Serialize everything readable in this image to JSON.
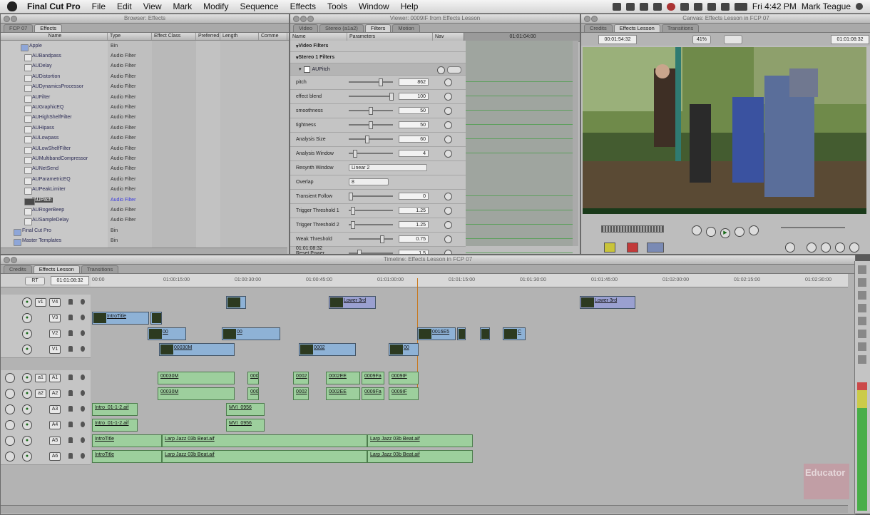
{
  "menubar": {
    "app_name": "Final Cut Pro",
    "items": [
      "File",
      "Edit",
      "View",
      "Mark",
      "Modify",
      "Sequence",
      "Effects",
      "Tools",
      "Window",
      "Help"
    ],
    "clock": "Fri 4:42 PM",
    "user": "Mark Teague"
  },
  "browser": {
    "title": "Browser: Effects",
    "tabs": [
      "FCP 07",
      "Effects"
    ],
    "columns": [
      "Name",
      "Type",
      "Effect Class",
      "Preferred",
      "Length",
      "Comme"
    ],
    "rows": [
      {
        "name": "Apple",
        "type": "Bin"
      },
      {
        "name": "AUBandpass",
        "type": "Audio Filter"
      },
      {
        "name": "AUDelay",
        "type": "Audio Filter"
      },
      {
        "name": "AUDistortion",
        "type": "Audio Filter"
      },
      {
        "name": "AUDynamicsProcessor",
        "type": "Audio Filter"
      },
      {
        "name": "AUFilter",
        "type": "Audio Filter"
      },
      {
        "name": "AUGraphicEQ",
        "type": "Audio Filter"
      },
      {
        "name": "AUHighShelfFilter",
        "type": "Audio Filter"
      },
      {
        "name": "AUHipass",
        "type": "Audio Filter"
      },
      {
        "name": "AULowpass",
        "type": "Audio Filter"
      },
      {
        "name": "AULowShelfFilter",
        "type": "Audio Filter"
      },
      {
        "name": "AUMultibandCompressor",
        "type": "Audio Filter"
      },
      {
        "name": "AUNetSend",
        "type": "Audio Filter"
      },
      {
        "name": "AUParametricEQ",
        "type": "Audio Filter"
      },
      {
        "name": "AUPeakLimiter",
        "type": "Audio Filter"
      },
      {
        "name": "AUPitch",
        "type": "Audio Filter"
      },
      {
        "name": "AURogerBeep",
        "type": "Audio Filter"
      },
      {
        "name": "AUSampleDelay",
        "type": "Audio Filter"
      },
      {
        "name": "Final Cut Pro",
        "type": "Bin"
      },
      {
        "name": "Master Templates",
        "type": "Bin"
      }
    ],
    "selected_index": 15
  },
  "viewer": {
    "title": "Viewer: 0009IF from Effects Lesson",
    "tabs": [
      "Video",
      "Stereo (a1a2)",
      "Filters",
      "Motion"
    ],
    "header": {
      "name": "Name",
      "params": "Parameters",
      "nav": "Nav"
    },
    "timecode_ruler": "01:01:04:00",
    "groups": [
      "Video Filters",
      "Stereo 1 Filters"
    ],
    "filter_name": "AUPitch",
    "params": [
      {
        "name": "pitch",
        "value": "862",
        "pos": 0.72
      },
      {
        "name": "effect blend",
        "value": "100",
        "pos": 0.98
      },
      {
        "name": "smoothness",
        "value": "50",
        "pos": 0.48
      },
      {
        "name": "tightness",
        "value": "50",
        "pos": 0.48
      },
      {
        "name": "Analysis Size",
        "value": "60",
        "pos": 0.4
      },
      {
        "name": "Analysis Window",
        "value": "4",
        "pos": 0.1
      },
      {
        "name": "Resynth Window",
        "select": "Linear 2"
      },
      {
        "name": "Overlap",
        "select": "8"
      },
      {
        "name": "Transient Follow",
        "value": "0",
        "pos": 0.0
      },
      {
        "name": "Trigger Threshold 1",
        "value": "1.25",
        "pos": 0.05
      },
      {
        "name": "Trigger Threshold 2",
        "value": "1.25",
        "pos": 0.05
      },
      {
        "name": "Weak Threshold",
        "value": "0.75",
        "pos": 0.75
      },
      {
        "name": "Reset Power",
        "value": "1.5",
        "pos": 0.2
      }
    ],
    "current_timecode": "01:01:08:32"
  },
  "canvas": {
    "title": "Canvas: Effects Lesson in FCP 07",
    "tabs": [
      "Credits",
      "Effects Lesson",
      "Transitions"
    ],
    "timecode_left": "00:01:54:32",
    "zoom": "41%",
    "timecode_right": "01:01:08:32"
  },
  "timeline": {
    "title": "Timeline: Effects Lesson in FCP 07",
    "tabs": [
      "Credits",
      "Effects Lesson",
      "Transitions"
    ],
    "rt": "RT",
    "timecode": "01:01:08:32",
    "ruler": [
      "00:00",
      "01:00:15:00",
      "01:00:30:00",
      "01:00:45:00",
      "01:01:00:00",
      "01:01:15:00",
      "01:01:30:00",
      "01:01:45:00",
      "01:02:00:00",
      "01:02:15:00",
      "01:02:30:00"
    ],
    "video_tracks": [
      {
        "src": "v1",
        "dest": "V4",
        "clips": [
          {
            "label": ""
          },
          {
            "label": "Lower 3rd"
          },
          {
            "label": "Lower 3rd"
          }
        ]
      },
      {
        "src": "",
        "dest": "V3",
        "clips": [
          {
            "label": "IntroTitle"
          },
          {
            "label": "Cro"
          }
        ]
      },
      {
        "src": "",
        "dest": "V2",
        "clips": [
          {
            "label": "00"
          },
          {
            "label": "00"
          },
          {
            "label": "0016E5"
          },
          {
            "label": "Fa"
          },
          {
            "label": "N"
          },
          {
            "label": "C"
          }
        ]
      },
      {
        "src": "",
        "dest": "V1",
        "clips": [
          {
            "label": "00030M"
          },
          {
            "label": "0002"
          },
          {
            "label": "00"
          }
        ]
      }
    ],
    "audio_tracks": [
      {
        "src": "a1",
        "dest": "A1",
        "clips": [
          {
            "label": "00030M"
          },
          {
            "label": "000"
          },
          {
            "label": "0002"
          },
          {
            "label": "0002EE"
          },
          {
            "label": "0009Fa"
          },
          {
            "label": "0009IF"
          }
        ]
      },
      {
        "src": "a2",
        "dest": "A2",
        "clips": [
          {
            "label": "00030M"
          },
          {
            "label": "000"
          },
          {
            "label": "0002"
          },
          {
            "label": "0002EE"
          },
          {
            "label": "0009Fa"
          },
          {
            "label": "0009IF"
          }
        ]
      },
      {
        "src": "",
        "dest": "A3",
        "clips": [
          {
            "label": "Intro_01-1-2.aif"
          },
          {
            "label": "MVI_0956"
          }
        ]
      },
      {
        "src": "",
        "dest": "A4",
        "clips": [
          {
            "label": "Intro_01-1-2.aif"
          },
          {
            "label": "MVI_0956"
          }
        ]
      },
      {
        "src": "",
        "dest": "A5",
        "clips": [
          {
            "label": "IntroTitle"
          },
          {
            "label": "Larp Jazz 03b Beat.aif"
          },
          {
            "label": "Larp Jazz 03b Beat.aif"
          }
        ]
      },
      {
        "src": "",
        "dest": "A6",
        "clips": [
          {
            "label": "IntroTitle"
          },
          {
            "label": "Larp Jazz 03b Beat.aif"
          },
          {
            "label": "Larp Jazz 03b Beat.aif"
          }
        ]
      }
    ]
  },
  "watermark": "Educator"
}
